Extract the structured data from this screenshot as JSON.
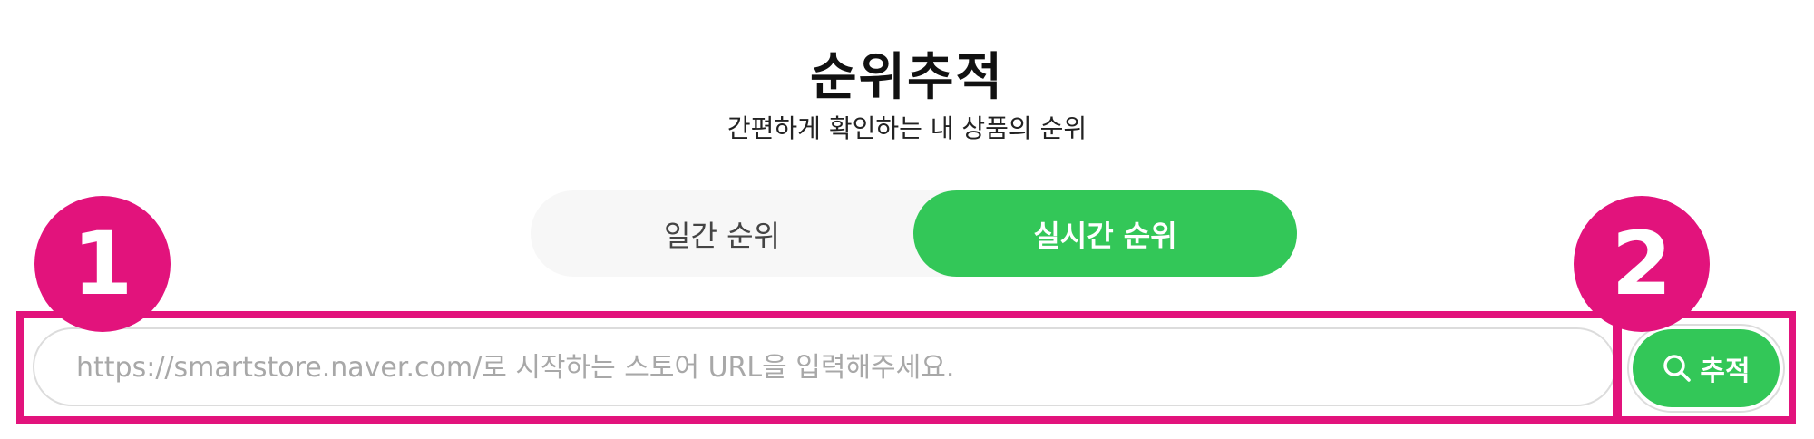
{
  "header": {
    "title": "순위추적",
    "subtitle": "간편하게 확인하는 내 상품의 순위"
  },
  "tabs": [
    {
      "label": "일간 순위",
      "active": false
    },
    {
      "label": "실시간 순위",
      "active": true
    }
  ],
  "search": {
    "placeholder": "https://smartstore.naver.com/로 시작하는 스토어 URL을 입력해주세요.",
    "value": "",
    "button_label": "추적",
    "button_icon": "search-icon"
  },
  "annotations": [
    {
      "label": "1"
    },
    {
      "label": "2"
    }
  ],
  "colors": {
    "accent": "#33c758",
    "annotation": "#e2137c",
    "tab_inactive_bg": "#f7f7f7",
    "border": "#dcdcdc"
  }
}
